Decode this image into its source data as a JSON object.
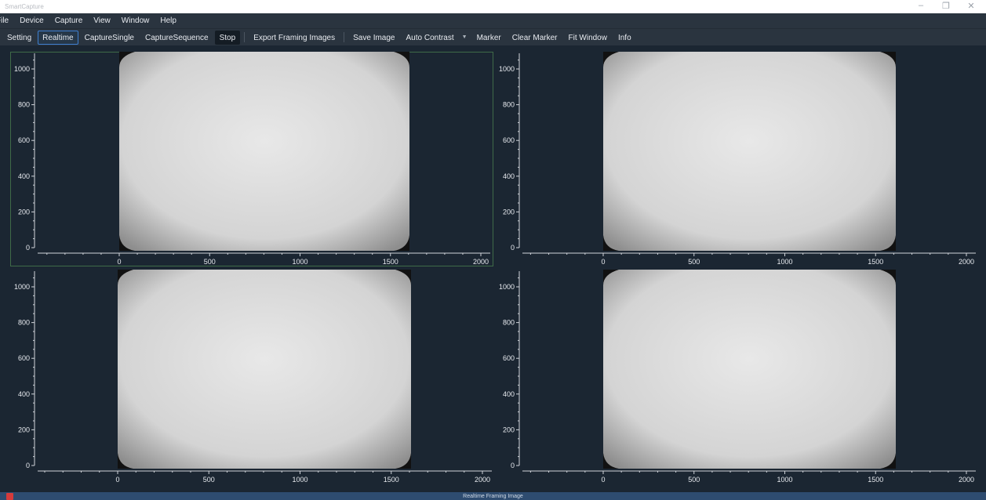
{
  "window": {
    "title": "SmartCapture",
    "controls": {
      "minimize": "–",
      "restore": "❐",
      "close": "✕"
    }
  },
  "menu": [
    "File",
    "Device",
    "Capture",
    "View",
    "Window",
    "Help"
  ],
  "toolbar": {
    "setting": "Setting",
    "realtime": "Realtime",
    "capture_single": "CaptureSingle",
    "capture_sequence": "CaptureSequence",
    "stop": "Stop",
    "export_framing_images": "Export Framing Images",
    "save_image": "Save Image",
    "auto_contrast": "Auto Contrast",
    "marker": "Marker",
    "clear_marker": "Clear Marker",
    "fit_window": "Fit Window",
    "info": "Info",
    "dropdown_arrow": "▼"
  },
  "plots": {
    "x_ticks": [
      "0",
      "500",
      "1000",
      "1500",
      "2000"
    ],
    "y_ticks": [
      "0",
      "200",
      "400",
      "600",
      "800",
      "1000"
    ],
    "count": 4
  },
  "status": {
    "text": "Realtime Framing Image"
  },
  "colors": {
    "background": "#1b2632",
    "toolbar": "#2a343f",
    "accent": "#3e7fd0",
    "selected_panel_border": "#3f6b48",
    "status_bar": "#2e4c70"
  }
}
